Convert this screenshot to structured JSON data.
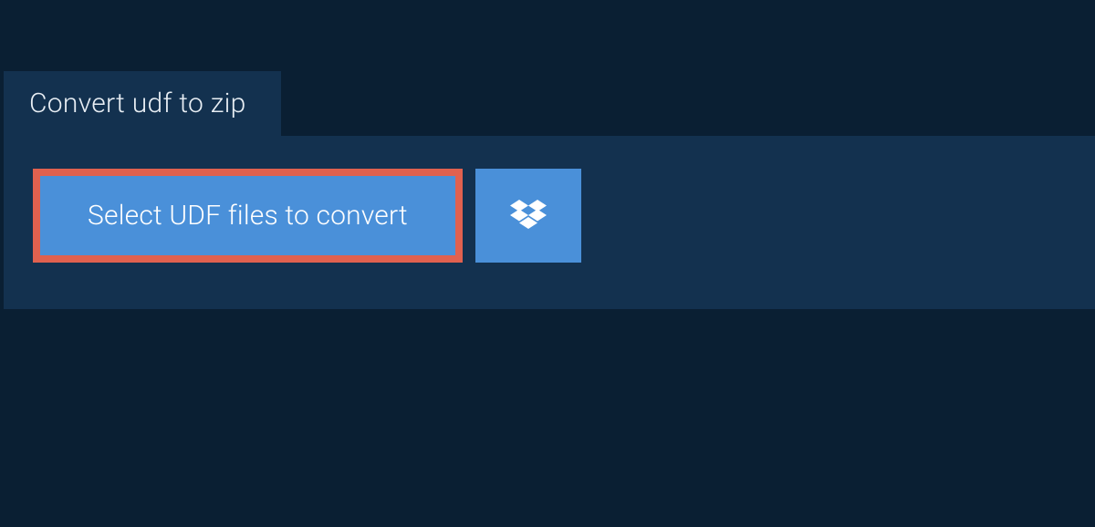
{
  "tab": {
    "title": "Convert udf to zip"
  },
  "actions": {
    "select_label": "Select UDF files to convert"
  },
  "colors": {
    "page_bg": "#0a1f33",
    "panel_bg": "#13314f",
    "button_bg": "#4a90d9",
    "highlight_border": "#e0614f",
    "text_light": "#ffffff"
  }
}
